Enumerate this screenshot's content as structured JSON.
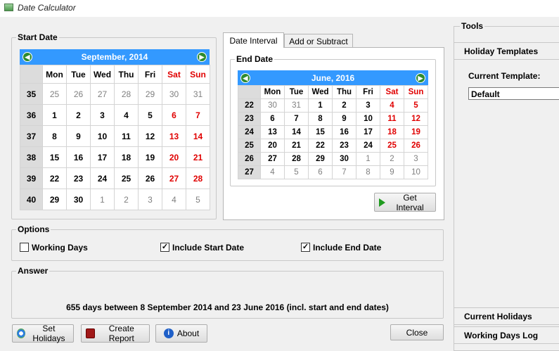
{
  "window": {
    "title": "Date Calculator"
  },
  "start_date": {
    "legend": "Start Date",
    "header": "September,  2014",
    "weekdays": [
      "Mon",
      "Tue",
      "Wed",
      "Thu",
      "Fri",
      "Sat",
      "Sun"
    ],
    "weeks": [
      {
        "wk": "35",
        "days": [
          [
            "25",
            1
          ],
          [
            "26",
            1
          ],
          [
            "27",
            1
          ],
          [
            "28",
            1
          ],
          [
            "29",
            1
          ],
          [
            "30",
            1
          ],
          [
            "31",
            1
          ]
        ]
      },
      {
        "wk": "36",
        "days": [
          [
            "1",
            0
          ],
          [
            "2",
            0
          ],
          [
            "3",
            0
          ],
          [
            "4",
            0
          ],
          [
            "5",
            0
          ],
          [
            "6",
            0
          ],
          [
            "7",
            0
          ]
        ]
      },
      {
        "wk": "37",
        "days": [
          [
            "8",
            0
          ],
          [
            "9",
            0
          ],
          [
            "10",
            0
          ],
          [
            "11",
            0
          ],
          [
            "12",
            0
          ],
          [
            "13",
            0
          ],
          [
            "14",
            0
          ]
        ]
      },
      {
        "wk": "38",
        "days": [
          [
            "15",
            0
          ],
          [
            "16",
            0
          ],
          [
            "17",
            0
          ],
          [
            "18",
            0
          ],
          [
            "19",
            0
          ],
          [
            "20",
            0
          ],
          [
            "21",
            0
          ]
        ]
      },
      {
        "wk": "39",
        "days": [
          [
            "22",
            0
          ],
          [
            "23",
            0
          ],
          [
            "24",
            0
          ],
          [
            "25",
            0
          ],
          [
            "26",
            0
          ],
          [
            "27",
            0
          ],
          [
            "28",
            0
          ]
        ]
      },
      {
        "wk": "40",
        "days": [
          [
            "29",
            0
          ],
          [
            "30",
            0
          ],
          [
            "1",
            1
          ],
          [
            "2",
            1
          ],
          [
            "3",
            1
          ],
          [
            "4",
            1
          ],
          [
            "5",
            1
          ]
        ]
      }
    ]
  },
  "tabs": {
    "interval": "Date Interval",
    "add_subtract": "Add or Subtract"
  },
  "end_date": {
    "legend": "End Date",
    "header": "June,  2016",
    "weekdays": [
      "Mon",
      "Tue",
      "Wed",
      "Thu",
      "Fri",
      "Sat",
      "Sun"
    ],
    "weeks": [
      {
        "wk": "22",
        "days": [
          [
            "30",
            1
          ],
          [
            "31",
            1
          ],
          [
            "1",
            0
          ],
          [
            "2",
            0
          ],
          [
            "3",
            0
          ],
          [
            "4",
            0
          ],
          [
            "5",
            0
          ]
        ]
      },
      {
        "wk": "23",
        "days": [
          [
            "6",
            0
          ],
          [
            "7",
            0
          ],
          [
            "8",
            0
          ],
          [
            "9",
            0
          ],
          [
            "10",
            0
          ],
          [
            "11",
            0
          ],
          [
            "12",
            0
          ]
        ]
      },
      {
        "wk": "24",
        "days": [
          [
            "13",
            0
          ],
          [
            "14",
            0
          ],
          [
            "15",
            0
          ],
          [
            "16",
            0
          ],
          [
            "17",
            0
          ],
          [
            "18",
            0
          ],
          [
            "19",
            0
          ]
        ]
      },
      {
        "wk": "25",
        "days": [
          [
            "20",
            0
          ],
          [
            "21",
            0
          ],
          [
            "22",
            0
          ],
          [
            "23",
            0
          ],
          [
            "24",
            0
          ],
          [
            "25",
            0
          ],
          [
            "26",
            0
          ]
        ]
      },
      {
        "wk": "26",
        "days": [
          [
            "27",
            0
          ],
          [
            "28",
            0
          ],
          [
            "29",
            0
          ],
          [
            "30",
            0
          ],
          [
            "1",
            1
          ],
          [
            "2",
            1
          ],
          [
            "3",
            1
          ]
        ]
      },
      {
        "wk": "27",
        "days": [
          [
            "4",
            1
          ],
          [
            "5",
            1
          ],
          [
            "6",
            1
          ],
          [
            "7",
            1
          ],
          [
            "8",
            1
          ],
          [
            "9",
            1
          ],
          [
            "10",
            1
          ]
        ]
      }
    ]
  },
  "get_interval": "Get Interval",
  "options": {
    "legend": "Options",
    "working_days": {
      "label": "Working Days",
      "checked": false
    },
    "include_start": {
      "label": "Include Start Date",
      "checked": true
    },
    "include_end": {
      "label": "Include End Date",
      "checked": true
    }
  },
  "answer": {
    "legend": "Answer",
    "text": "655 days between 8 September 2014 and 23 June 2016 (incl. start and end dates)"
  },
  "buttons": {
    "set_holidays": "Set Holidays",
    "create_report": "Create Report",
    "about": "About",
    "close": "Close"
  },
  "tools": {
    "legend": "Tools",
    "holiday_templates": "Holiday Templates",
    "current_template_label": "Current Template:",
    "current_template_value": "Default",
    "current_holidays": "Current Holidays",
    "working_days_log": "Working Days Log"
  },
  "colors": {
    "accent": "#3399ff",
    "weekend": "#e00000",
    "nav": "#2e8b2e"
  }
}
